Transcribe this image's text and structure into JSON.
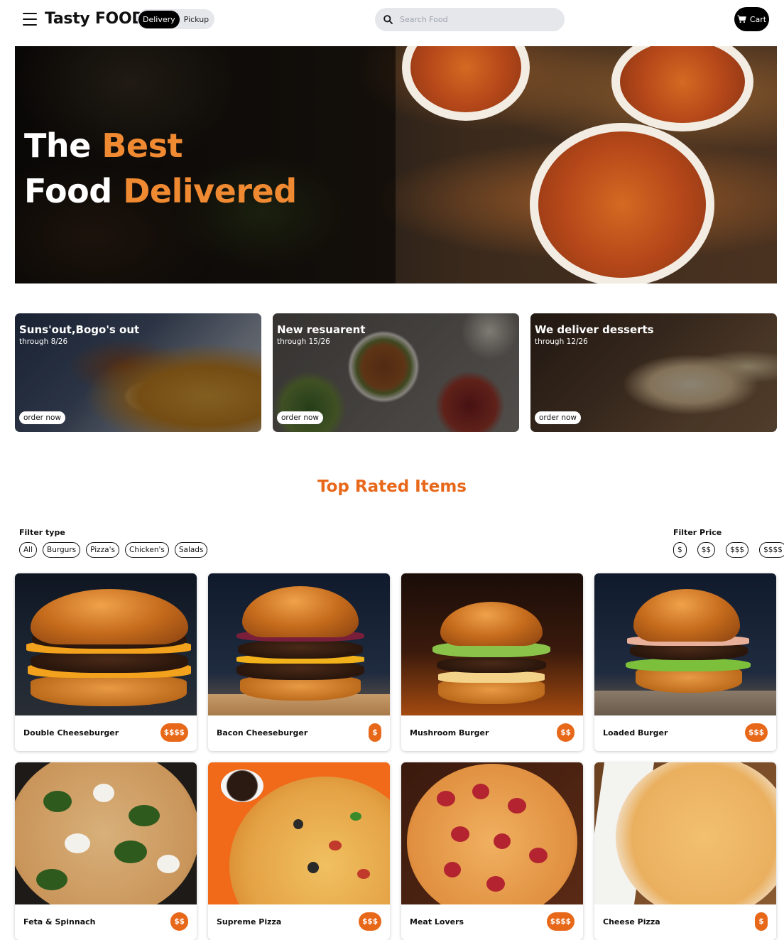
{
  "navbar": {
    "brand": "Tasty FOODS",
    "modes": [
      "Delivery",
      "Pickup"
    ],
    "active_mode": "Delivery",
    "search_placeholder": "Search Food",
    "cart_label": "Cart"
  },
  "hero": {
    "line1_white": "The",
    "line1_orange": "Best",
    "line2_white": "Food",
    "line2_orange": "Delivered"
  },
  "promos": [
    {
      "title": "Suns'out,Bogo's out",
      "subtitle": "through 8/26",
      "button": "order now"
    },
    {
      "title": "New resuarent",
      "subtitle": "through 15/26",
      "button": "order now"
    },
    {
      "title": "We deliver desserts",
      "subtitle": "through 12/26",
      "button": "order now"
    }
  ],
  "section_title": "Top Rated Items",
  "filters": {
    "type_label": "Filter type",
    "types": [
      "All",
      "Burgurs",
      "Pizza's",
      "Chicken's",
      "Salads"
    ],
    "price_label": "Filter Price",
    "prices": [
      "$",
      "$$",
      "$$$",
      "$$$$"
    ]
  },
  "items": [
    {
      "name": "Double Cheeseburger",
      "price": "$$$$"
    },
    {
      "name": "Bacon Cheeseburger",
      "price": "$"
    },
    {
      "name": "Mushroom Burger",
      "price": "$$"
    },
    {
      "name": "Loaded Burger",
      "price": "$$$"
    },
    {
      "name": "Feta & Spinnach",
      "price": "$$"
    },
    {
      "name": "Supreme Pizza",
      "price": "$$$"
    },
    {
      "name": "Meat Lovers",
      "price": "$$$$"
    },
    {
      "name": "Cheese Pizza",
      "price": "$"
    }
  ],
  "colors": {
    "accent": "#e8681a",
    "hero_accent": "#f08a32",
    "black": "#000000",
    "search_bg": "#e5e7eb"
  },
  "icons": {
    "menu": "hamburger-menu-icon",
    "search": "search-icon",
    "cart": "cart-icon"
  }
}
